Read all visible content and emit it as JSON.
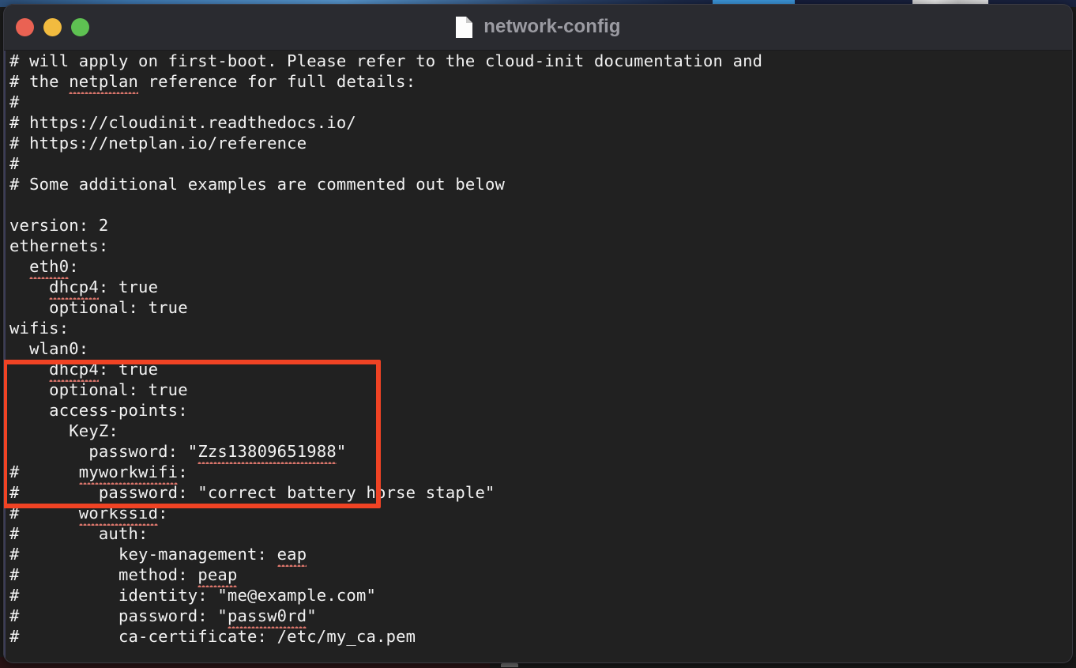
{
  "window": {
    "title": "network-config",
    "doc_icon": "document-icon",
    "traffic_lights": [
      {
        "name": "close",
        "color": "#ea6253"
      },
      {
        "name": "minimize",
        "color": "#f2bb3f"
      },
      {
        "name": "maximize",
        "color": "#5ec152"
      }
    ]
  },
  "annotation": {
    "color": "#f04324",
    "shape": "rectangle-highlight",
    "target": "wifis-block"
  },
  "editor": {
    "language": "yaml",
    "background": "#212121",
    "foreground": "#f2f2f2",
    "squiggle_color": "#d9756b",
    "lines": [
      {
        "text": "# will apply on first-boot. Please refer to the cloud-init documentation and",
        "misspelled": []
      },
      {
        "text": "# the netplan reference for full details:",
        "misspelled": [
          "netplan"
        ]
      },
      {
        "text": "#",
        "misspelled": []
      },
      {
        "text": "# https://cloudinit.readthedocs.io/",
        "misspelled": []
      },
      {
        "text": "# https://netplan.io/reference",
        "misspelled": []
      },
      {
        "text": "#",
        "misspelled": []
      },
      {
        "text": "# Some additional examples are commented out below",
        "misspelled": []
      },
      {
        "text": "",
        "misspelled": []
      },
      {
        "text": "version: 2",
        "misspelled": []
      },
      {
        "text": "ethernets:",
        "misspelled": []
      },
      {
        "text": "  eth0:",
        "misspelled": [
          "eth0"
        ]
      },
      {
        "text": "    dhcp4: true",
        "misspelled": [
          "dhcp4"
        ]
      },
      {
        "text": "    optional: true",
        "misspelled": []
      },
      {
        "text": "wifis:",
        "misspelled": []
      },
      {
        "text": "  wlan0:",
        "misspelled": []
      },
      {
        "text": "    dhcp4: true",
        "misspelled": [
          "dhcp4"
        ]
      },
      {
        "text": "    optional: true",
        "misspelled": []
      },
      {
        "text": "    access-points:",
        "misspelled": []
      },
      {
        "text": "      KeyZ:",
        "misspelled": []
      },
      {
        "text": "        password: \"Zzs13809651988\"",
        "misspelled": [
          "Zzs13809651988"
        ]
      },
      {
        "text": "#      myworkwifi:",
        "misspelled": [
          "myworkwifi"
        ]
      },
      {
        "text": "#        password: \"correct battery horse staple\"",
        "misspelled": []
      },
      {
        "text": "#      workssid:",
        "misspelled": [
          "workssid"
        ]
      },
      {
        "text": "#        auth:",
        "misspelled": []
      },
      {
        "text": "#          key-management: eap",
        "misspelled": [
          "eap"
        ]
      },
      {
        "text": "#          method: peap",
        "misspelled": [
          "peap"
        ]
      },
      {
        "text": "#          identity: \"me@example.com\"",
        "misspelled": []
      },
      {
        "text": "#          password: \"passw0rd\"",
        "misspelled": [
          "passw0rd"
        ]
      },
      {
        "text": "#          ca-certificate: /etc/my_ca.pem",
        "misspelled": []
      }
    ]
  }
}
